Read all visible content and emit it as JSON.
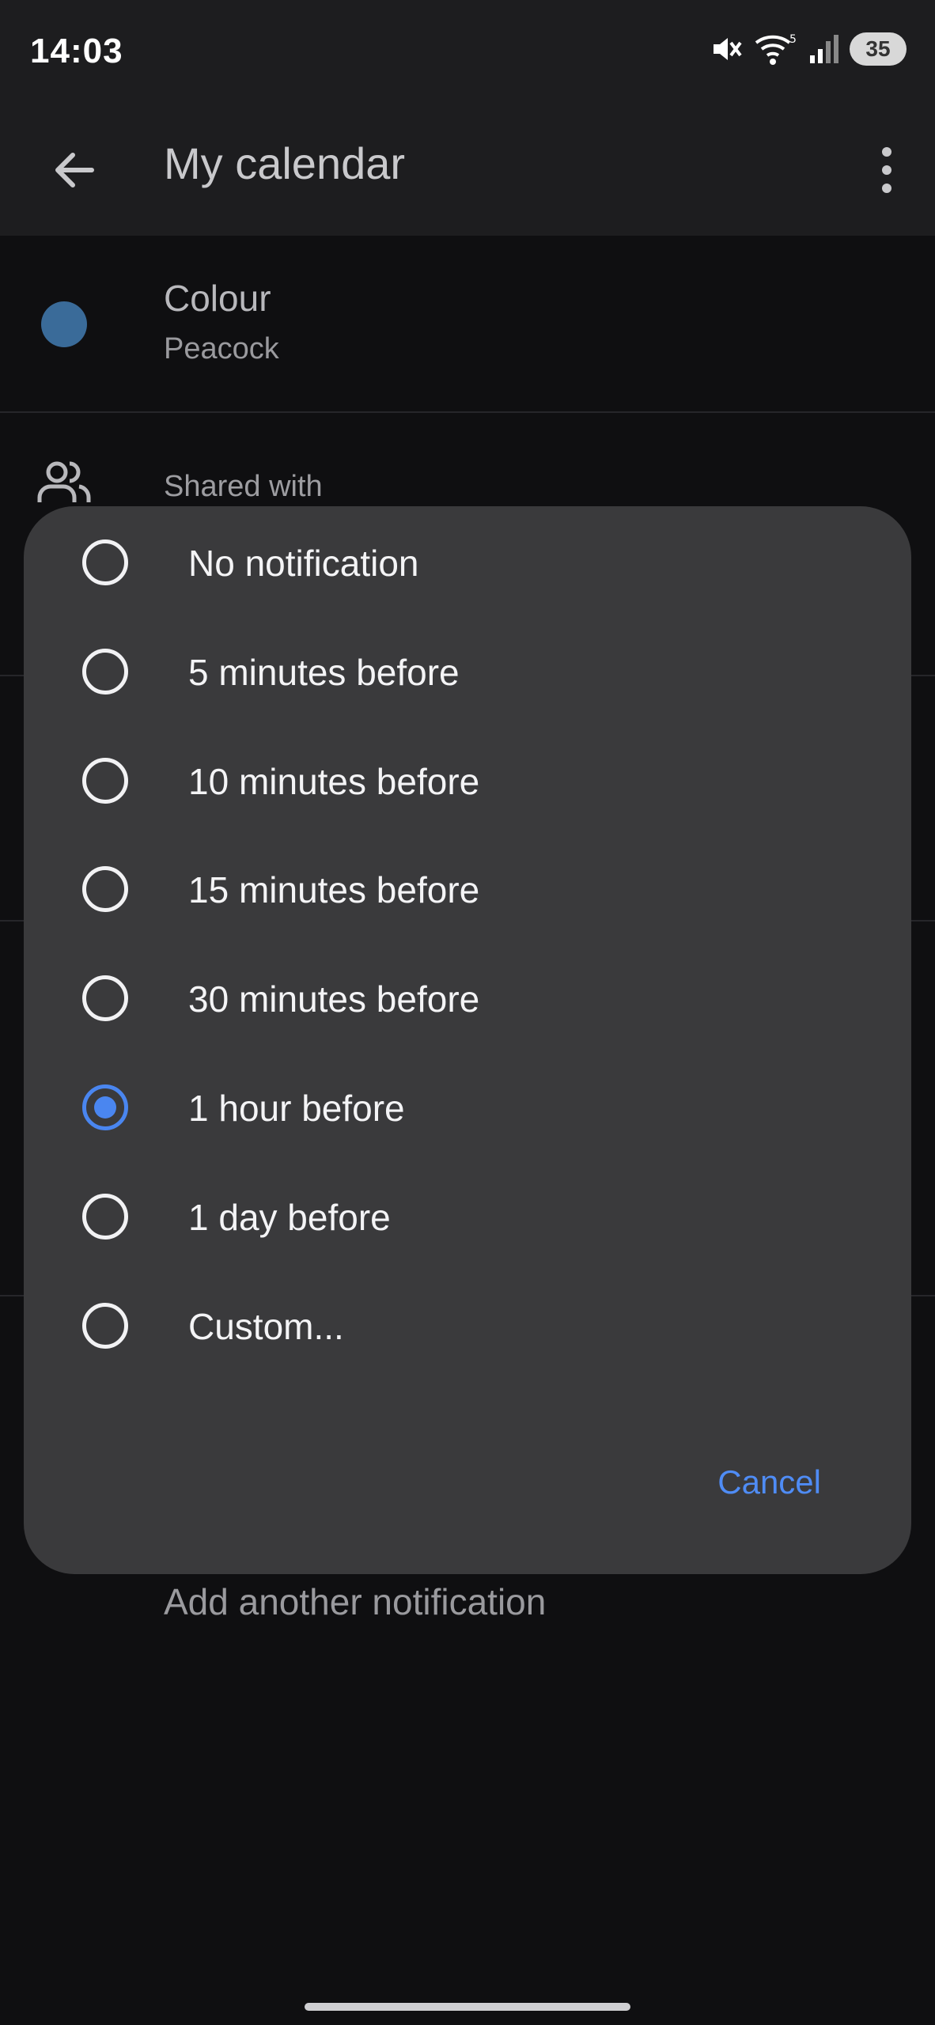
{
  "status_bar": {
    "time": "14:03",
    "battery": "35",
    "wifi_label": "5"
  },
  "app_bar": {
    "title": "My calendar"
  },
  "settings": {
    "colour_label": "Colour",
    "colour_value": "Peacock",
    "colour_swatch": "#3a6b99",
    "shared_label": "Shared with",
    "add_notification": "Add another notification"
  },
  "dialog": {
    "options": [
      {
        "label": "No notification",
        "selected": false
      },
      {
        "label": "5 minutes before",
        "selected": false
      },
      {
        "label": "10 minutes before",
        "selected": false
      },
      {
        "label": "15 minutes before",
        "selected": false
      },
      {
        "label": "30 minutes before",
        "selected": false
      },
      {
        "label": "1 hour before",
        "selected": true
      },
      {
        "label": "1 day before",
        "selected": false
      },
      {
        "label": "Custom...",
        "selected": false
      }
    ],
    "cancel_label": "Cancel"
  },
  "colors": {
    "accent": "#4a86f0",
    "dialog_bg": "#3a3a3c",
    "background": "#0f0f11"
  }
}
